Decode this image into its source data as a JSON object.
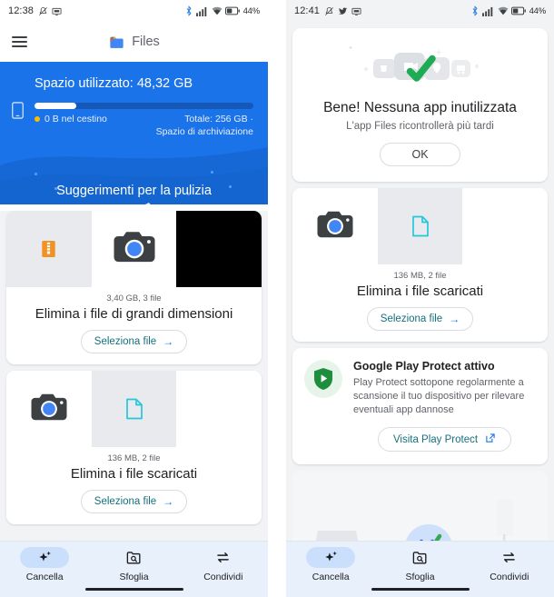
{
  "left": {
    "status": {
      "time": "12:38",
      "silent_icon": "mute-icon",
      "cast_icon": "cast-icon",
      "bluetooth_icon": "bluetooth-icon",
      "signal_icon": "signal-bars-icon",
      "wifi_icon": "wifi-icon",
      "battery_icon": "battery-icon",
      "battery_level": "44%"
    },
    "appbar": {
      "menu_icon": "hamburger-menu-icon",
      "logo_icon": "files-logo-icon",
      "title": "Files"
    },
    "hero": {
      "title": "Spazio utilizzato: 48,32 GB",
      "device_icon": "phone-storage-icon",
      "progress_percent": 19,
      "trash_label": "0 B nel cestino",
      "total_line1": "Totale: 256 GB ·",
      "total_line2": "Spazio di archiviazione",
      "subtitle": "Suggerimenti per la pulizia",
      "background_color": "#1a73e8"
    },
    "cards": [
      {
        "meta": "3,40 GB, 3 file",
        "title": "Elimina i file di grandi dimensioni",
        "button": "Seleziona file",
        "button_icon": "arrow-right-icon",
        "thumbs": [
          "zip-file-thumb",
          "camera-app-thumb",
          "black-video-thumb"
        ]
      },
      {
        "meta": "136 MB, 2 file",
        "title": "Elimina i file scaricati",
        "button": "Seleziona file",
        "button_icon": "arrow-right-icon",
        "thumbs": [
          "camera-app-thumb",
          "document-file-thumb",
          "empty-thumb"
        ]
      }
    ],
    "nav": [
      {
        "label": "Cancella",
        "icon": "sparkle-clean-icon",
        "active": true
      },
      {
        "label": "Sfoglia",
        "icon": "browse-folder-search-icon",
        "active": false
      },
      {
        "label": "Condividi",
        "icon": "share-transfer-icon",
        "active": false
      }
    ]
  },
  "right": {
    "status": {
      "time": "12:41",
      "silent_icon": "mute-icon",
      "twitter_icon": "twitter-icon",
      "cast_icon": "cast-icon",
      "bluetooth_icon": "bluetooth-icon",
      "signal_icon": "signal-bars-icon",
      "wifi_icon": "wifi-icon",
      "battery_icon": "battery-icon",
      "battery_level": "44%"
    },
    "ok_card": {
      "illustration_icon": "apps-checkmark-illustration",
      "title": "Bene! Nessuna app inutilizzata",
      "subtitle": "L'app Files ricontrollerà più tardi",
      "button": "OK"
    },
    "download_card": {
      "meta": "136 MB, 2 file",
      "title": "Elimina i file scaricati",
      "button": "Seleziona file",
      "button_icon": "arrow-right-icon",
      "thumbs": [
        "camera-app-thumb",
        "document-file-thumb",
        "empty-thumb"
      ]
    },
    "play_protect": {
      "badge_icon": "play-protect-shield-icon",
      "title": "Google Play Protect attivo",
      "description": "Play Protect sottopone regolarmente a scansione il tuo dispositivo per rilevare eventuali app dannose",
      "button": "Visita Play Protect",
      "button_icon": "external-link-icon"
    },
    "peek_card": {
      "illustration_icon": "smiling-blob-broom-illustration"
    },
    "nav": [
      {
        "label": "Cancella",
        "icon": "sparkle-clean-icon",
        "active": true
      },
      {
        "label": "Sfoglia",
        "icon": "browse-folder-search-icon",
        "active": false
      },
      {
        "label": "Condividi",
        "icon": "share-transfer-icon",
        "active": false
      }
    ]
  },
  "colors": {
    "accent_blue": "#1a73e8",
    "teal_link": "#15717d",
    "green": "#34a853",
    "amber": "#fbbc04",
    "nav_bg": "#e8f0fb"
  }
}
